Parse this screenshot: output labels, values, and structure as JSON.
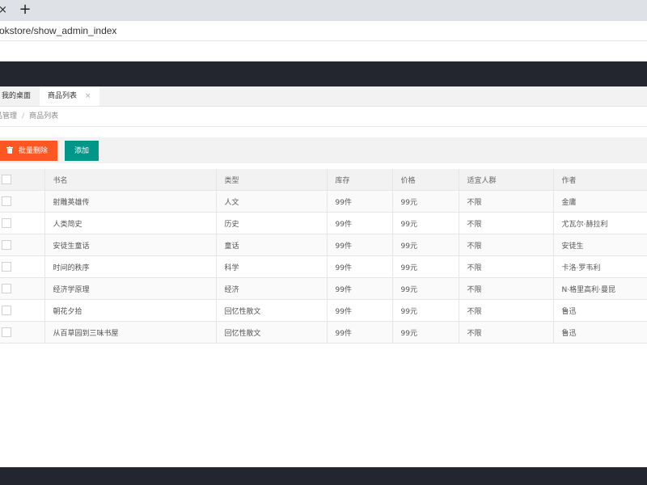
{
  "browser": {
    "tab_close_icon": "×",
    "new_tab_icon": "+",
    "url": "okstore/show_admin_index"
  },
  "page_tabs": {
    "home_label": "我的桌面",
    "active_label": "商品列表",
    "close_icon": "×"
  },
  "breadcrumb": {
    "items": [
      "品管理",
      "商品列表"
    ],
    "separator": "/"
  },
  "toolbar": {
    "delete_label": "批量删除",
    "delete_icon": "trash-icon",
    "add_label": "添加",
    "colors": {
      "delete": "#ff5722",
      "add": "#009688"
    }
  },
  "table": {
    "columns": [
      "书名",
      "类型",
      "库存",
      "价格",
      "适宜人群",
      "作者"
    ],
    "rows": [
      [
        "射雕英雄传",
        "人文",
        "99件",
        "99元",
        "不限",
        "金庸"
      ],
      [
        "人类简史",
        "历史",
        "99件",
        "99元",
        "不限",
        "尤瓦尔·赫拉利"
      ],
      [
        "安徒生童话",
        "童话",
        "99件",
        "99元",
        "不限",
        "安徒生"
      ],
      [
        "时间的秩序",
        "科学",
        "99件",
        "99元",
        "不限",
        "卡洛·罗韦利"
      ],
      [
        "经济学原理",
        "经济",
        "99件",
        "99元",
        "不限",
        "N·格里高利·曼昆"
      ],
      [
        "朝花夕拾",
        "回忆性散文",
        "99件",
        "99元",
        "不限",
        "鲁迅"
      ],
      [
        "从百草园到三味书屋",
        "回忆性散文",
        "99件",
        "99元",
        "不限",
        "鲁迅"
      ]
    ]
  },
  "theme": {
    "header_bg": "#23262e"
  }
}
